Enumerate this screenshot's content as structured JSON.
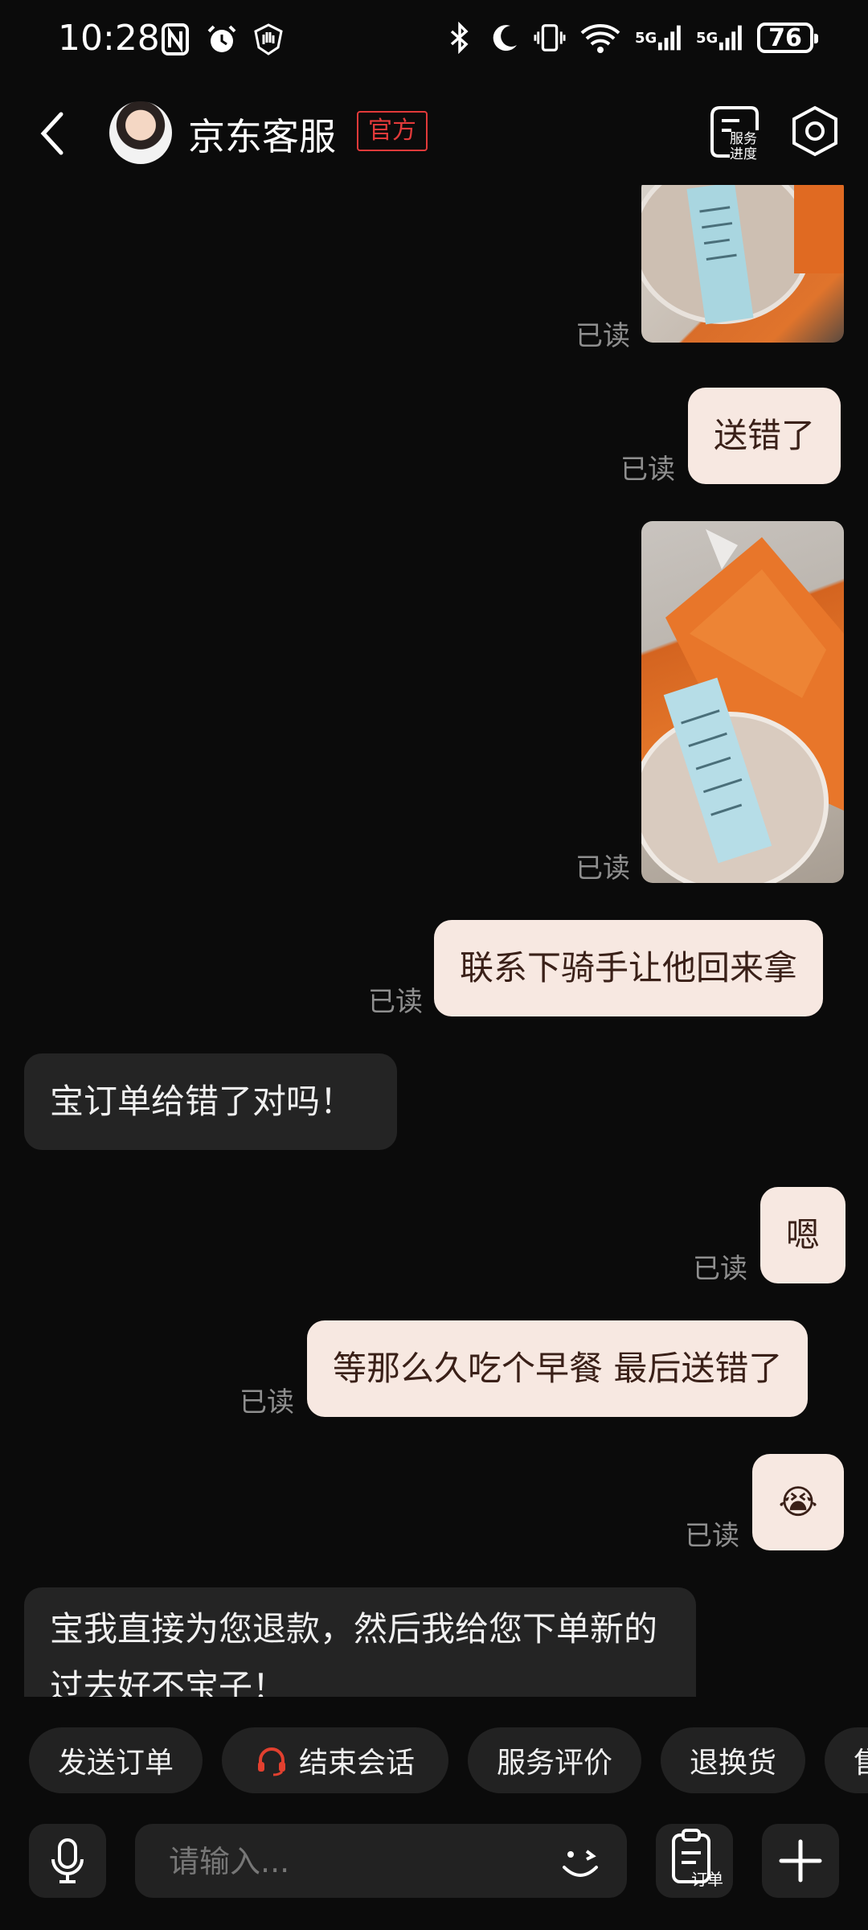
{
  "status_bar": {
    "time": "10:28",
    "battery": "76",
    "network_1": "5G",
    "network_2": "5G",
    "wifi_badge": "6"
  },
  "header": {
    "title": "京东客服",
    "badge": "官方",
    "service_progress": "服务进度"
  },
  "chat": {
    "read_label": "已读",
    "messages": [
      {
        "type": "image",
        "dir": "out",
        "desc": "food-receipt-photo",
        "read": "已读"
      },
      {
        "type": "text",
        "dir": "out",
        "text": "送错了",
        "read": "已读"
      },
      {
        "type": "image",
        "dir": "out",
        "desc": "orange-bag-receipt-photo",
        "read": "已读"
      },
      {
        "type": "text",
        "dir": "out",
        "text": "联系下骑手让他回来拿",
        "read": "已读"
      },
      {
        "type": "text",
        "dir": "in",
        "text": "宝订单给错了对吗！"
      },
      {
        "type": "text",
        "dir": "out",
        "text": "嗯",
        "read": "已读"
      },
      {
        "type": "text",
        "dir": "out",
        "text": "等那么久吃个早餐  最后送错了",
        "read": "已读"
      },
      {
        "type": "emoji",
        "dir": "out",
        "text": "😭",
        "read": "已读"
      },
      {
        "type": "text",
        "dir": "in",
        "text": "宝我直接为您退款，然后我给您下单新的过去好不宝子！"
      }
    ]
  },
  "quick_actions": [
    "发送订单",
    "结束会话",
    "服务评价",
    "退换货",
    "售"
  ],
  "input": {
    "placeholder": "请输入...",
    "order_label": "订单"
  },
  "colors": {
    "background": "#0b0b0b",
    "outgoing_bubble": "#f7e8e1",
    "incoming_bubble": "#242424",
    "badge_red": "#e23a3a",
    "chip_bg": "#222222"
  }
}
